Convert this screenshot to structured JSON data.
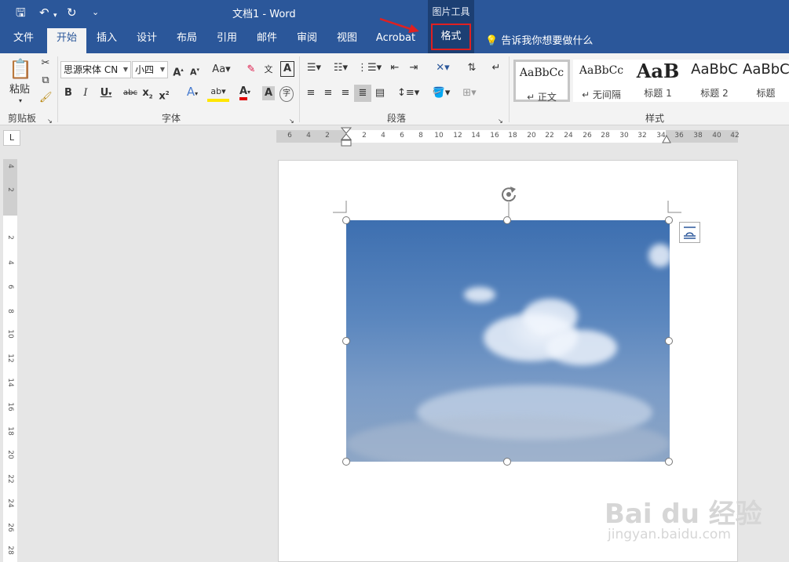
{
  "titlebar": {
    "doc_title": "文档1  -  Word",
    "context_group": "图片工具",
    "qa_save": "🖫",
    "qa_undo": "↶",
    "qa_redo": "↻",
    "qa_more": "⌄"
  },
  "tabs": [
    {
      "label": "文件"
    },
    {
      "label": "开始"
    },
    {
      "label": "插入"
    },
    {
      "label": "设计"
    },
    {
      "label": "布局"
    },
    {
      "label": "引用"
    },
    {
      "label": "邮件"
    },
    {
      "label": "审阅"
    },
    {
      "label": "视图"
    },
    {
      "label": "Acrobat"
    },
    {
      "label": "格式"
    }
  ],
  "tell_me": "告诉我你想要做什么",
  "ribbon": {
    "clipboard": {
      "paste_label": "粘贴",
      "group_label": "剪贴板"
    },
    "font": {
      "font_name": "思源宋体 CN",
      "font_size": "小四",
      "group_label": "字体"
    },
    "paragraph": {
      "group_label": "段落"
    },
    "styles": {
      "group_label": "样式",
      "items": [
        {
          "preview": "AaBbCc",
          "name": "↵ 正文"
        },
        {
          "preview": "AaBbCc",
          "name": "↵ 无间隔"
        },
        {
          "preview": "AaB",
          "name": "标题 1"
        },
        {
          "preview": "AaBbC",
          "name": "标题 2"
        },
        {
          "preview": "AaBbC",
          "name": "标题"
        }
      ]
    }
  },
  "hruler_numbers": [
    "6",
    "4",
    "2",
    "2",
    "4",
    "6",
    "8",
    "10",
    "12",
    "14",
    "16",
    "18",
    "20",
    "22",
    "24",
    "26",
    "28",
    "30",
    "32",
    "34",
    "36",
    "38",
    "40",
    "42"
  ],
  "vruler_numbers": [
    "4",
    "2",
    "2",
    "4",
    "6",
    "8",
    "10",
    "12",
    "14",
    "16",
    "18",
    "20",
    "22",
    "24",
    "26",
    "28"
  ],
  "tab_selector": "L",
  "watermark": {
    "brand": "Bai du 经验",
    "url": "jingyan.baidu.com"
  }
}
